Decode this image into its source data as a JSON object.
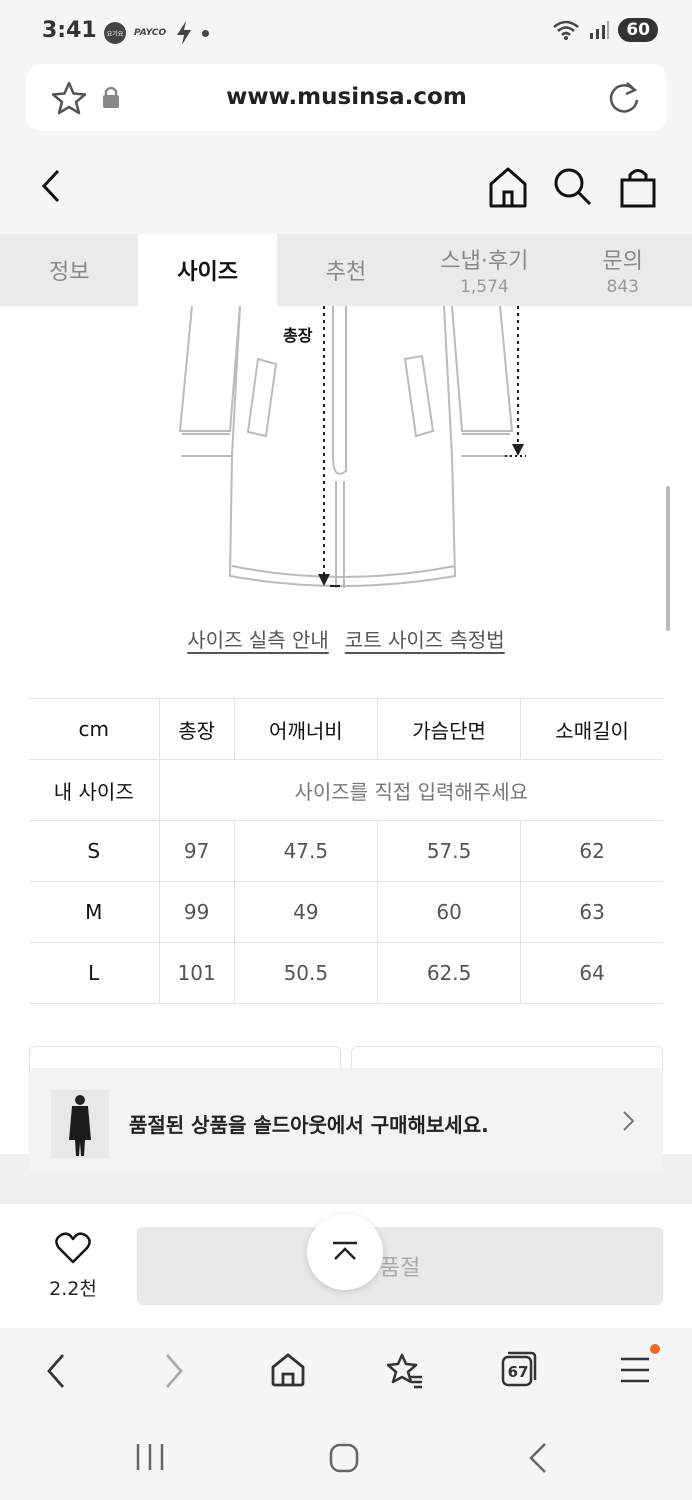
{
  "status": {
    "time": "3:41",
    "app_badge_1": "요기요",
    "app_badge_2": "PAYCO",
    "battery": "60"
  },
  "browser": {
    "url": "www.musinsa.com",
    "tabs_count": "67"
  },
  "tabs": [
    {
      "label": "정보",
      "count": ""
    },
    {
      "label": "사이즈",
      "count": ""
    },
    {
      "label": "추천",
      "count": ""
    },
    {
      "label": "스냅·후기",
      "count": "1,574"
    },
    {
      "label": "문의",
      "count": "843"
    }
  ],
  "diagram": {
    "length_label": "총장"
  },
  "links": {
    "size_guide": "사이즈 실측 안내",
    "coat_measure": "코트 사이즈 측정법"
  },
  "size_table": {
    "header": [
      "cm",
      "총장",
      "어깨너비",
      "가슴단면",
      "소매길이"
    ],
    "my_size_label": "내 사이즈",
    "my_size_placeholder": "사이즈를 직접 입력해주세요",
    "rows": [
      [
        "S",
        "97",
        "47.5",
        "57.5",
        "62"
      ],
      [
        "M",
        "99",
        "49",
        "60",
        "63"
      ],
      [
        "L",
        "101",
        "50.5",
        "62.5",
        "64"
      ]
    ]
  },
  "banner": {
    "text": "품절된 상품을 솔드아웃에서 구매해보세요."
  },
  "action": {
    "like_count": "2.2천",
    "buy_label": "품절"
  },
  "colors": {
    "accent_dot": "#f06a1e",
    "tab_bg": "#eaeaea"
  }
}
